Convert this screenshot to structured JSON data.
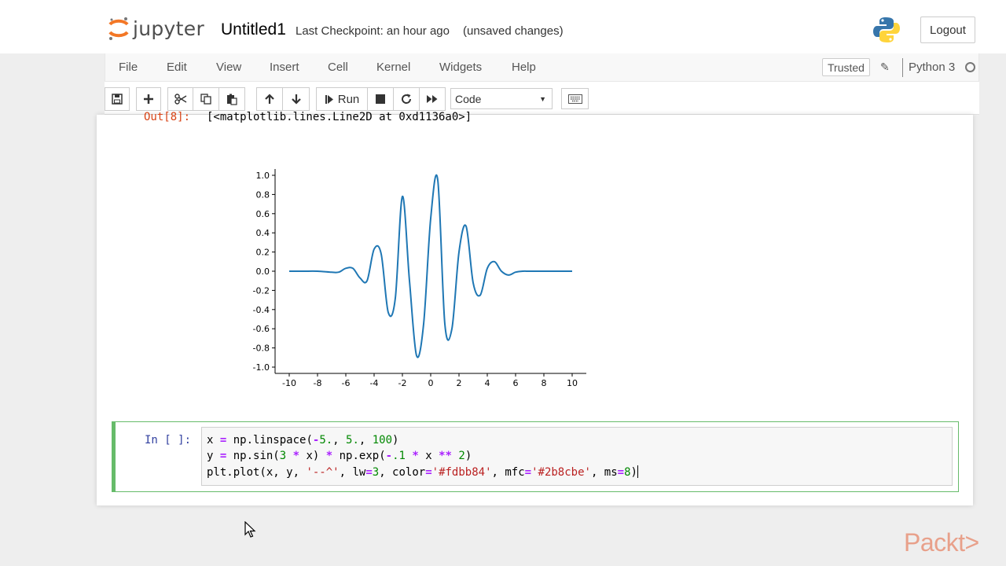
{
  "header": {
    "logo_text": "jupyter",
    "notebook_name": "Untitled1",
    "checkpoint": "Last Checkpoint: an hour ago",
    "unsaved": "(unsaved changes)",
    "logout_label": "Logout"
  },
  "menubar": {
    "items": [
      "File",
      "Edit",
      "View",
      "Insert",
      "Cell",
      "Kernel",
      "Widgets",
      "Help"
    ],
    "trusted_label": "Trusted",
    "kernel_name": "Python 3"
  },
  "toolbar": {
    "run_label": "Run",
    "cell_type": "Code"
  },
  "output": {
    "prompt": "Out[8]:",
    "text": "[<matplotlib.lines.Line2D at 0xd1136a0>]"
  },
  "chart_data": {
    "type": "line",
    "xlim": [
      -10,
      10
    ],
    "ylim": [
      -1.0,
      1.0
    ],
    "xticks": [
      "-10",
      "-8",
      "-6",
      "-4",
      "-2",
      "0",
      "2",
      "4",
      "6",
      "8",
      "10"
    ],
    "yticks": [
      "1.0",
      "0.8",
      "0.6",
      "0.4",
      "0.2",
      "0.0",
      "-0.2",
      "-0.4",
      "-0.6",
      "-0.8",
      "-1.0"
    ],
    "series": [
      {
        "color": "#1f77b4",
        "x": [
          -10,
          -9,
          -8,
          -7,
          -6.5,
          -6,
          -5.5,
          -5,
          -4.5,
          -4,
          -3.5,
          -3,
          -2.5,
          -2,
          -1.5,
          -1,
          -0.5,
          0,
          0.5,
          1,
          1.5,
          2,
          2.5,
          3,
          3.5,
          4,
          4.5,
          5,
          5.5,
          6,
          6.5,
          7,
          8,
          9,
          10
        ],
        "y": [
          0.0,
          0.0,
          0.0,
          -0.01,
          -0.01,
          0.03,
          0.03,
          -0.07,
          -0.1,
          0.23,
          0.18,
          -0.43,
          -0.28,
          0.78,
          -0.1,
          -0.88,
          -0.55,
          0.55,
          0.95,
          -0.55,
          -0.6,
          0.2,
          0.47,
          -0.12,
          -0.25,
          0.03,
          0.1,
          0.0,
          -0.04,
          -0.01,
          0.0,
          0.0,
          0.0,
          0.0,
          0.0
        ]
      }
    ]
  },
  "input": {
    "prompt": "In [ ]:",
    "lines": [
      "x = np.linspace(-5., 5., 100)",
      "y = np.sin(3 * x) * np.exp(-.1 * x ** 2)",
      "plt.plot(x, y, '--^', lw=3, color='#fdbb84', mfc='#2b8cbe', ms=8)"
    ]
  },
  "watermark": "Packt>"
}
